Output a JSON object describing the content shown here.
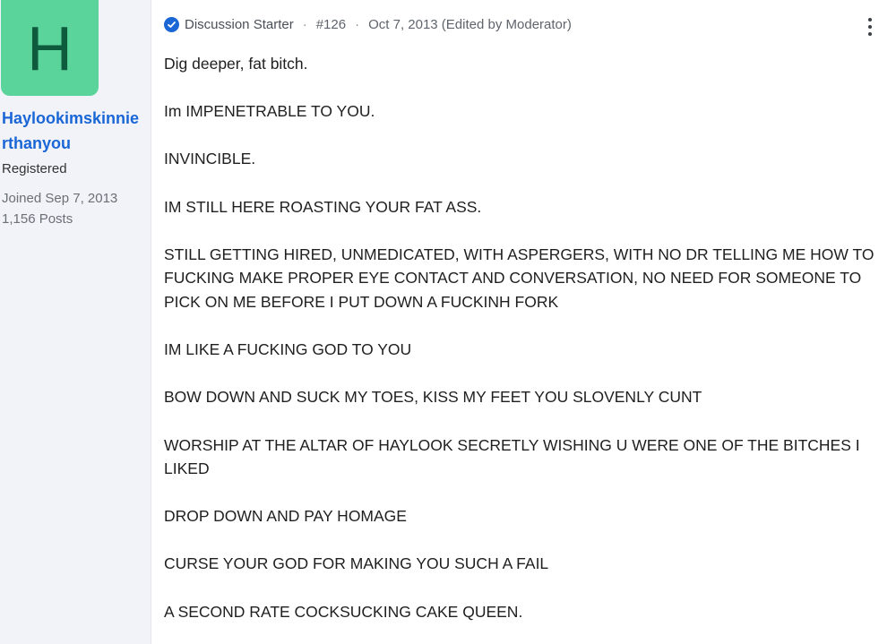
{
  "author": {
    "avatar_letter": "H",
    "username": "Haylookimskinnierthanyou",
    "role": "Registered",
    "joined": "Joined Sep 7, 2013",
    "posts": "1,156 Posts"
  },
  "meta": {
    "badge": "Discussion Starter",
    "post_number": "#126",
    "date": "Oct 7, 2013 (Edited by Moderator)",
    "separator": "·"
  },
  "paragraphs": [
    "Dig deeper, fat bitch.",
    "Im IMPENETRABLE TO YOU.",
    "INVINCIBLE.",
    "IM STILL HERE ROASTING YOUR FAT ASS.",
    "STILL GETTING HIRED, UNMEDICATED, WITH ASPERGERS, WITH NO DR TELLING ME HOW TO FUCKING MAKE PROPER EYE CONTACT AND CONVERSATION, NO NEED FOR SOMEONE TO PICK ON ME BEFORE I PUT DOWN A FUCKINH FORK",
    "IM LIKE A FUCKING GOD TO YOU",
    "BOW DOWN AND SUCK MY TOES, KISS MY FEET YOU SLOVENLY CUNT",
    "WORSHIP AT THE ALTAR OF HAYLOOK SECRETLY WISHING U WERE ONE OF THE BITCHES I LIKED",
    "DROP DOWN AND PAY HOMAGE",
    "CURSE YOUR GOD FOR MAKING YOU SUCH A FAIL",
    "A SECOND RATE COCKSUCKING CAKE QUEEN."
  ],
  "icons": {
    "check": "verified-check-icon",
    "menu": "more-vertical-icon"
  },
  "colors": {
    "avatar_bg": "#5ad49b",
    "avatar_fg": "#0e5a3c",
    "link": "#1a66d6",
    "sidebar_bg": "#f1f3f8"
  }
}
